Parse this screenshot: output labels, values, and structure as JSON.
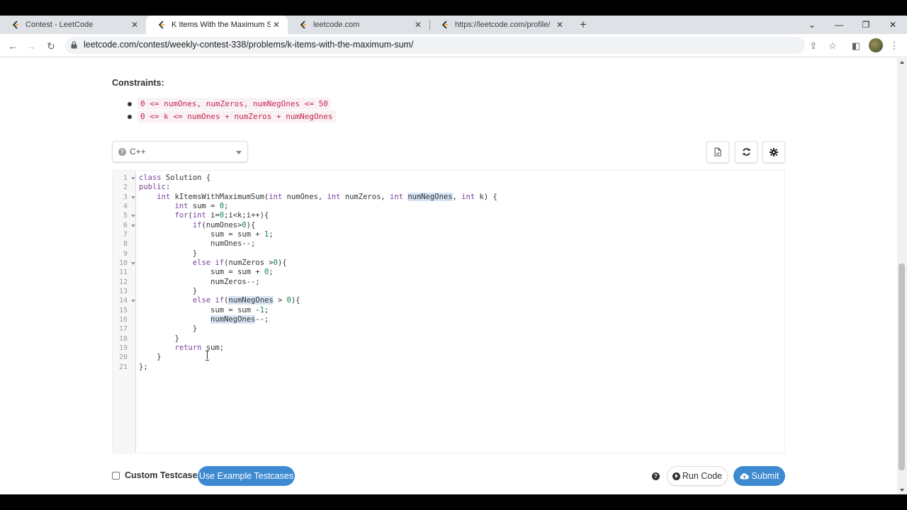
{
  "browser": {
    "tabs": [
      {
        "title": "Contest - LeetCode",
        "active": false
      },
      {
        "title": "K Items With the Maximum Sum",
        "active": true
      },
      {
        "title": "leetcode.com",
        "active": false
      },
      {
        "title": "https://leetcode.com/profile/",
        "active": false
      }
    ],
    "url": "leetcode.com/contest/weekly-contest-338/problems/k-items-with-the-maximum-sum/",
    "window_controls": {
      "minimize": "—",
      "maximize": "❐",
      "close": "✕"
    }
  },
  "problem": {
    "constraints_title": "Constraints:",
    "constraints": [
      "0 <= numOnes, numZeros, numNegOnes <= 50",
      "0 <= k <= numOnes + numZeros + numNegOnes"
    ]
  },
  "editor": {
    "language": "C++",
    "language_help": "?",
    "line_numbers": [
      "1",
      "2",
      "3",
      "4",
      "5",
      "6",
      "7",
      "8",
      "9",
      "10",
      "11",
      "12",
      "13",
      "14",
      "15",
      "16",
      "17",
      "18",
      "19",
      "20",
      "21"
    ],
    "foldable_lines": [
      1,
      3,
      5,
      6,
      10,
      14
    ]
  },
  "actions": {
    "custom_testcase_label": "Custom Testcase",
    "use_example_label": "Use Example Testcases",
    "help": "?",
    "run_label": "Run Code",
    "submit_label": "Submit"
  },
  "colors": {
    "accent_blue": "#3d8ad1",
    "constraint_code_text": "#c7254e",
    "constraint_code_bg": "#f9f2f4",
    "keyword": "#7a3e9d"
  }
}
